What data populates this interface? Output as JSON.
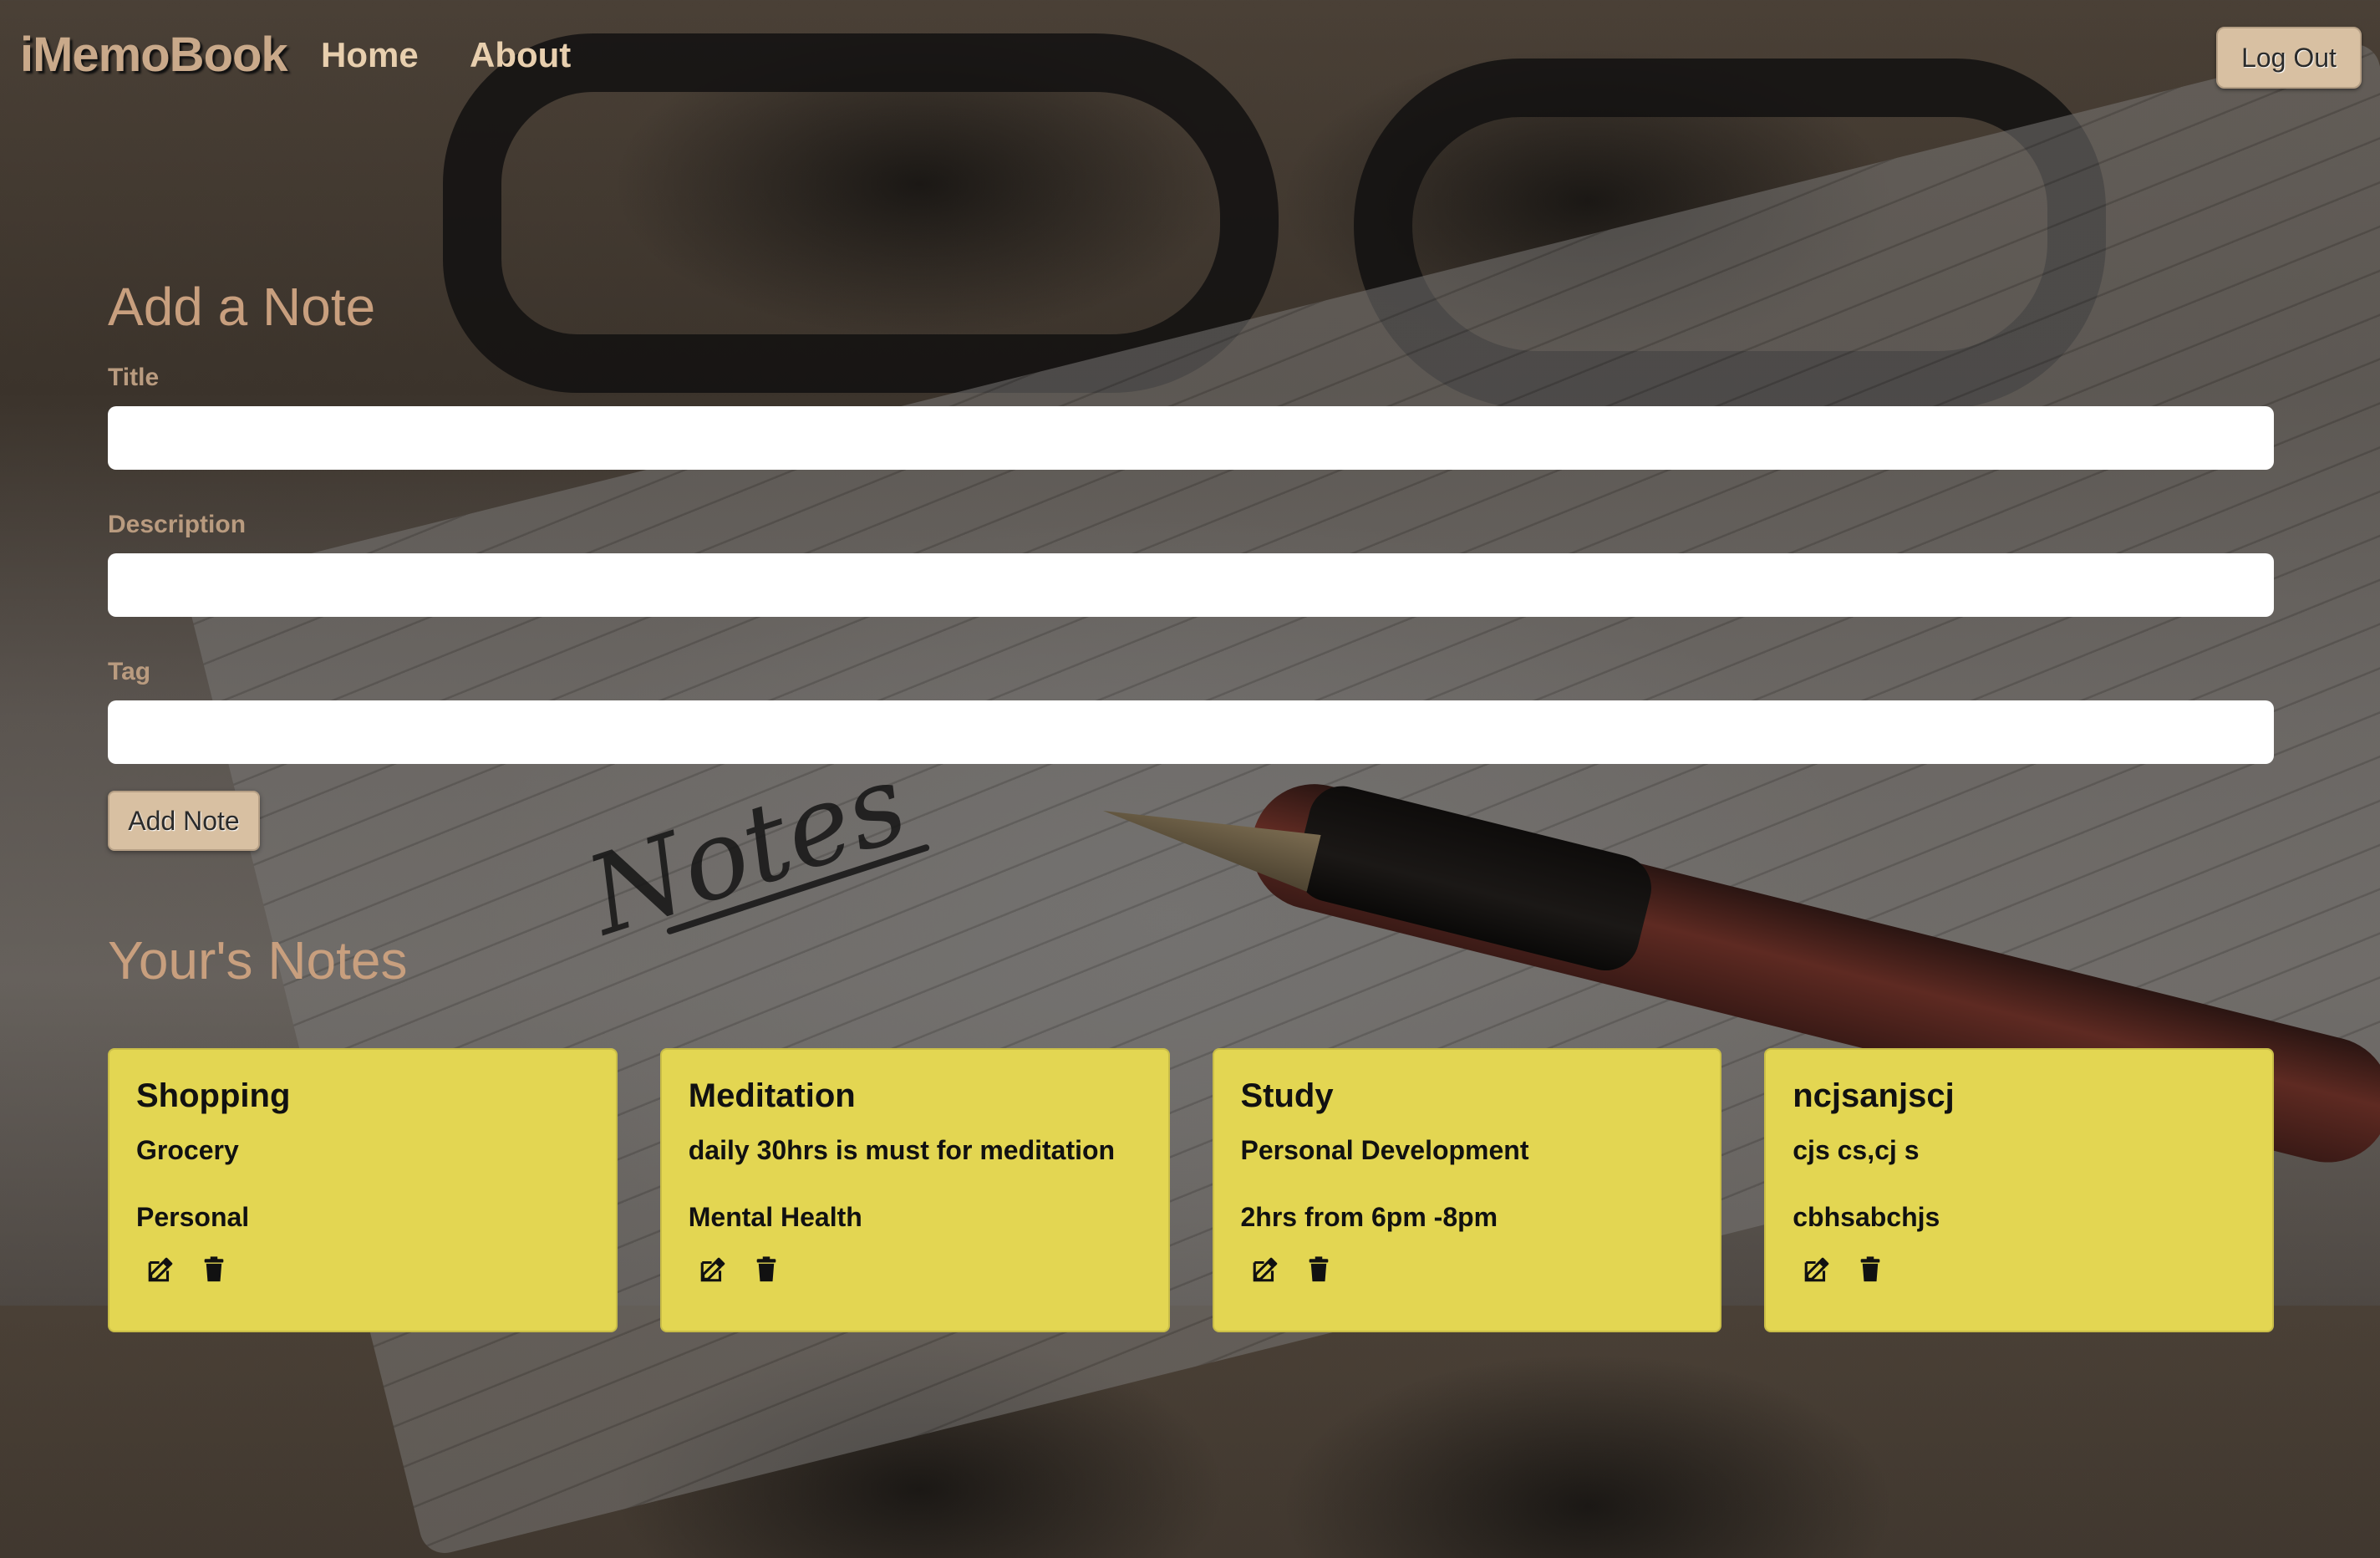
{
  "navbar": {
    "brand": "iMemoBook",
    "links": [
      {
        "label": "Home"
      },
      {
        "label": "About"
      }
    ],
    "logout_label": "Log Out"
  },
  "form": {
    "heading": "Add a Note",
    "title_label": "Title",
    "title_value": "",
    "description_label": "Description",
    "description_value": "",
    "tag_label": "Tag",
    "tag_value": "",
    "submit_label": "Add Note"
  },
  "notes": {
    "heading": "Your's Notes",
    "items": [
      {
        "title": "Shopping",
        "description": "Grocery",
        "tag": "Personal",
        "icons": [
          "edit-icon",
          "trash-icon"
        ]
      },
      {
        "title": "Meditation",
        "description": "daily 30hrs is must for meditation",
        "tag": "Mental Health",
        "icons": [
          "edit-icon",
          "trash-icon"
        ]
      },
      {
        "title": "Study",
        "description": "Personal Development",
        "tag": "2hrs from 6pm -8pm",
        "icons": [
          "edit-icon",
          "trash-icon"
        ]
      },
      {
        "title": "ncjsanjscj",
        "description": "cjs cs,cj s",
        "tag": "cbhsabchjs",
        "icons": [
          "edit-icon",
          "trash-icon"
        ]
      }
    ]
  },
  "colors": {
    "card_bg": "#e3d652",
    "accent_text": "#c89f7e",
    "button_bg": "#d8c0a2"
  }
}
